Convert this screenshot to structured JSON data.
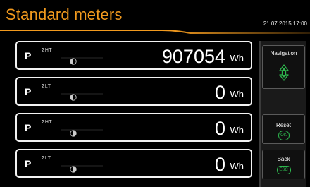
{
  "header": {
    "title": "Standard meters",
    "datetime": "21.07.2015 17:00",
    "accent_color": "#f29a1e"
  },
  "meters": [
    {
      "symbol": "P",
      "tag": "ΣHT",
      "value": "907054",
      "unit": "Wh"
    },
    {
      "symbol": "P",
      "tag": "ΣLT",
      "value": "0",
      "unit": "Wh"
    },
    {
      "symbol": "P",
      "tag": "ΣHT",
      "value": "0",
      "unit": "Wh"
    },
    {
      "symbol": "P",
      "tag": "ΣLT",
      "value": "0",
      "unit": "Wh"
    }
  ],
  "side_panel": {
    "navigation": {
      "label": "Navigation",
      "icon": "up-down-arrows-icon"
    },
    "reset": {
      "label": "Reset",
      "button": "OK"
    },
    "back": {
      "label": "Back",
      "button": "ESC"
    },
    "button_color": "#2eb84e"
  }
}
